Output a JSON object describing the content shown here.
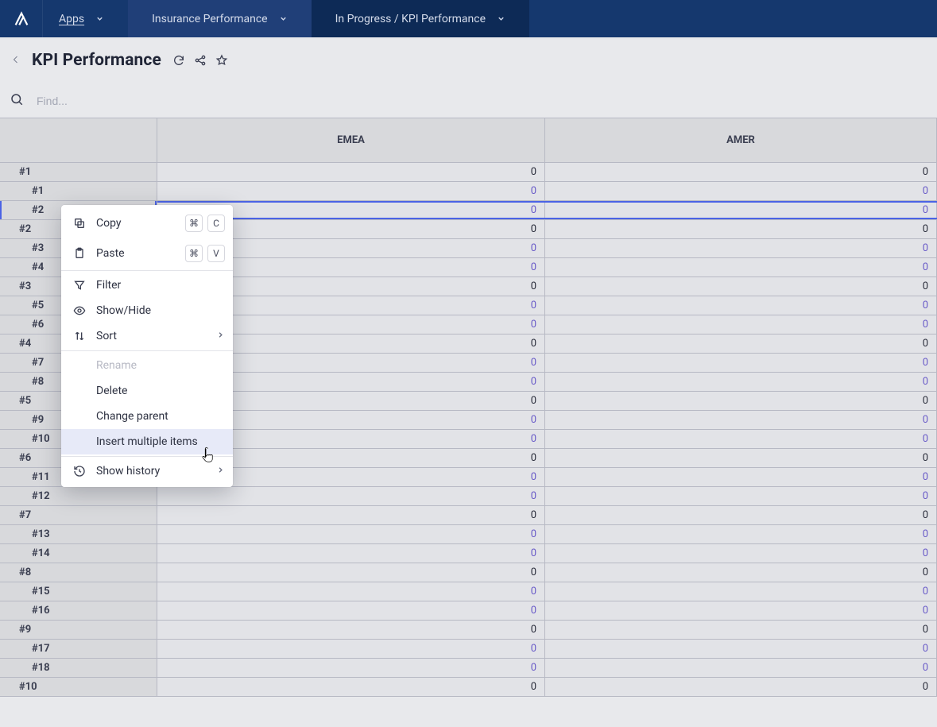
{
  "nav": {
    "apps_label": "Apps",
    "model_label": "Insurance Performance",
    "page_label": "In Progress / KPI Performance"
  },
  "page": {
    "title": "KPI Performance"
  },
  "search": {
    "placeholder": "Find..."
  },
  "columns": [
    "EMEA",
    "AMER"
  ],
  "rows": [
    {
      "label": "#1",
      "level": "parent",
      "emea": "0",
      "amer": "0",
      "selected": false
    },
    {
      "label": "#1",
      "level": "child",
      "emea": "0",
      "amer": "0",
      "selected": false
    },
    {
      "label": "#2",
      "level": "child",
      "emea": "0",
      "amer": "0",
      "selected": true
    },
    {
      "label": "#2",
      "level": "parent",
      "emea": "0",
      "amer": "0",
      "selected": false
    },
    {
      "label": "#3",
      "level": "child",
      "emea": "0",
      "amer": "0",
      "selected": false
    },
    {
      "label": "#4",
      "level": "child",
      "emea": "0",
      "amer": "0",
      "selected": false
    },
    {
      "label": "#3",
      "level": "parent",
      "emea": "0",
      "amer": "0",
      "selected": false
    },
    {
      "label": "#5",
      "level": "child",
      "emea": "0",
      "amer": "0",
      "selected": false
    },
    {
      "label": "#6",
      "level": "child",
      "emea": "0",
      "amer": "0",
      "selected": false
    },
    {
      "label": "#4",
      "level": "parent",
      "emea": "0",
      "amer": "0",
      "selected": false
    },
    {
      "label": "#7",
      "level": "child",
      "emea": "0",
      "amer": "0",
      "selected": false
    },
    {
      "label": "#8",
      "level": "child",
      "emea": "0",
      "amer": "0",
      "selected": false
    },
    {
      "label": "#5",
      "level": "parent",
      "emea": "0",
      "amer": "0",
      "selected": false
    },
    {
      "label": "#9",
      "level": "child",
      "emea": "0",
      "amer": "0",
      "selected": false
    },
    {
      "label": "#10",
      "level": "child",
      "emea": "0",
      "amer": "0",
      "selected": false
    },
    {
      "label": "#6",
      "level": "parent",
      "emea": "0",
      "amer": "0",
      "selected": false
    },
    {
      "label": "#11",
      "level": "child",
      "emea": "0",
      "amer": "0",
      "selected": false
    },
    {
      "label": "#12",
      "level": "child",
      "emea": "0",
      "amer": "0",
      "selected": false
    },
    {
      "label": "#7",
      "level": "parent",
      "emea": "0",
      "amer": "0",
      "selected": false
    },
    {
      "label": "#13",
      "level": "child",
      "emea": "0",
      "amer": "0",
      "selected": false
    },
    {
      "label": "#14",
      "level": "child",
      "emea": "0",
      "amer": "0",
      "selected": false
    },
    {
      "label": "#8",
      "level": "parent",
      "emea": "0",
      "amer": "0",
      "selected": false
    },
    {
      "label": "#15",
      "level": "child",
      "emea": "0",
      "amer": "0",
      "selected": false
    },
    {
      "label": "#16",
      "level": "child",
      "emea": "0",
      "amer": "0",
      "selected": false
    },
    {
      "label": "#9",
      "level": "parent",
      "emea": "0",
      "amer": "0",
      "selected": false
    },
    {
      "label": "#17",
      "level": "child",
      "emea": "0",
      "amer": "0",
      "selected": false
    },
    {
      "label": "#18",
      "level": "child",
      "emea": "0",
      "amer": "0",
      "selected": false
    },
    {
      "label": "#10",
      "level": "parent",
      "emea": "0",
      "amer": "0",
      "selected": false
    }
  ],
  "context_menu": {
    "items": [
      {
        "icon": "copy",
        "label": "Copy",
        "keys": [
          "⌘",
          "C"
        ]
      },
      {
        "icon": "paste",
        "label": "Paste",
        "keys": [
          "⌘",
          "V"
        ]
      },
      {
        "sep": true
      },
      {
        "icon": "filter",
        "label": "Filter"
      },
      {
        "icon": "eye",
        "label": "Show/Hide"
      },
      {
        "icon": "sort",
        "label": "Sort",
        "submenu": true
      },
      {
        "sep": true
      },
      {
        "icon": "",
        "label": "Rename",
        "disabled": true
      },
      {
        "icon": "",
        "label": "Delete"
      },
      {
        "icon": "",
        "label": "Change parent"
      },
      {
        "icon": "",
        "label": "Insert multiple items",
        "highlight": true
      },
      {
        "sep": true
      },
      {
        "icon": "history",
        "label": "Show history",
        "submenu": true
      }
    ]
  }
}
